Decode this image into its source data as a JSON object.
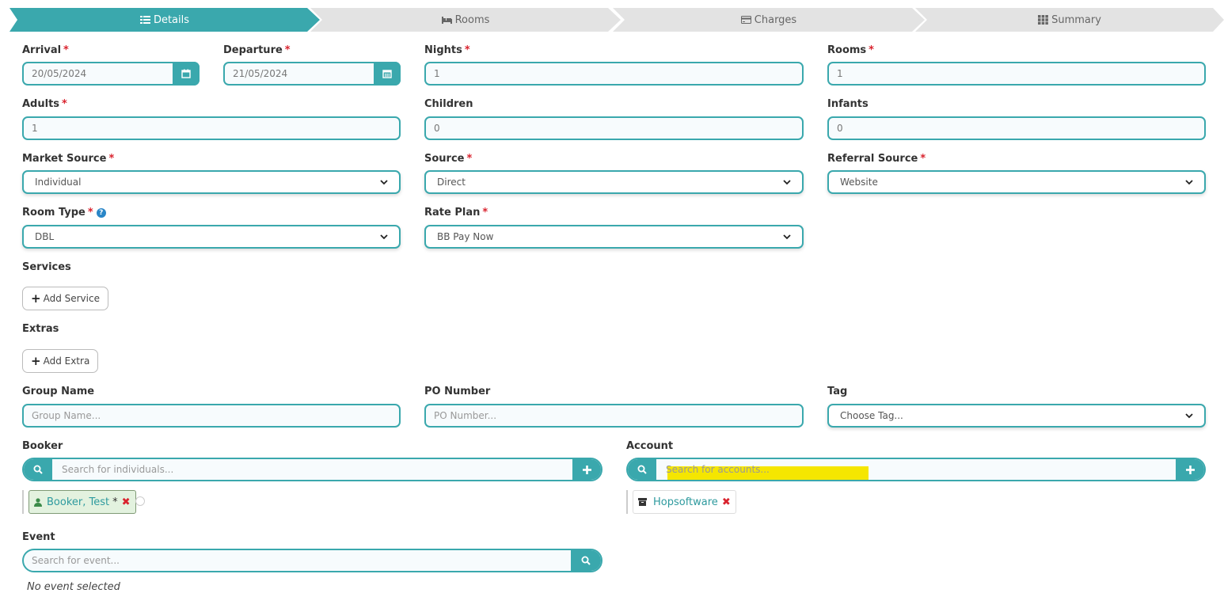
{
  "wizard": {
    "steps": [
      {
        "label": "Details",
        "icon": "list-icon",
        "active": true
      },
      {
        "label": "Rooms",
        "icon": "bed-icon",
        "active": false
      },
      {
        "label": "Charges",
        "icon": "credit-card-icon",
        "active": false
      },
      {
        "label": "Summary",
        "icon": "grid-icon",
        "active": false
      }
    ]
  },
  "form": {
    "arrival": {
      "label": "Arrival",
      "value": "20/05/2024",
      "required": "*"
    },
    "departure": {
      "label": "Departure",
      "value": "21/05/2024",
      "required": "*"
    },
    "nights": {
      "label": "Nights",
      "value": "1",
      "required": "*"
    },
    "rooms": {
      "label": "Rooms",
      "value": "1",
      "required": "*"
    },
    "adults": {
      "label": "Adults",
      "value": "1",
      "required": "*"
    },
    "children": {
      "label": "Children",
      "value": "0"
    },
    "infants": {
      "label": "Infants",
      "value": "0"
    },
    "market_source": {
      "label": "Market Source",
      "value": "Individual",
      "required": "*"
    },
    "source": {
      "label": "Source",
      "value": "Direct",
      "required": "*"
    },
    "referral_source": {
      "label": "Referral Source",
      "value": "Website",
      "required": "*"
    },
    "room_type": {
      "label": "Room Type",
      "value": "DBL",
      "required": "*",
      "help": "?"
    },
    "rate_plan": {
      "label": "Rate Plan",
      "value": "BB Pay Now",
      "required": "*"
    },
    "services": {
      "label": "Services",
      "button": "Add Service"
    },
    "extras": {
      "label": "Extras",
      "button": "Add Extra"
    },
    "group_name": {
      "label": "Group Name",
      "placeholder": "Group Name..."
    },
    "po_number": {
      "label": "PO Number",
      "placeholder": "PO Number..."
    },
    "tag": {
      "label": "Tag",
      "value": "Choose Tag..."
    },
    "booker": {
      "label": "Booker",
      "placeholder": "Search for individuals...",
      "chip": "Booker, Test",
      "chip_star": "*"
    },
    "account": {
      "label": "Account",
      "placeholder": "Search for accounts...",
      "chip": "Hopsoftware"
    },
    "event": {
      "label": "Event",
      "placeholder": "Search for event...",
      "none_text": "No event selected"
    }
  },
  "colors": {
    "accent": "#3aa8ad",
    "required": "#d9232e",
    "highlight": "#f5e600"
  }
}
